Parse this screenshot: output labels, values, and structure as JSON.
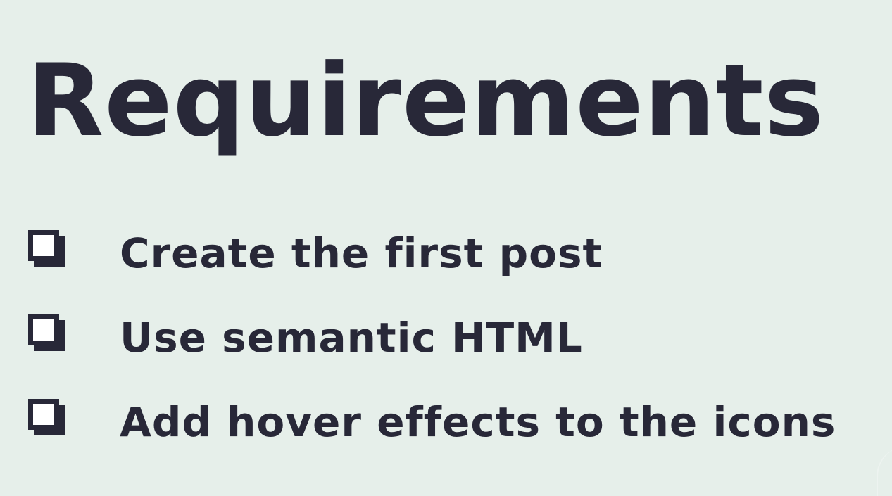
{
  "slide": {
    "title": "Requirements",
    "requirements": [
      {
        "label": "Create the first post",
        "checked": false
      },
      {
        "label": "Use semantic HTML",
        "checked": false
      },
      {
        "label": "Add hover effects to the icons",
        "checked": false
      }
    ]
  },
  "colors": {
    "background": "#e6efea",
    "text": "#282838",
    "checkbox_fill": "#ffffff"
  },
  "icons": {
    "checkbox": "checkbox-icon"
  }
}
